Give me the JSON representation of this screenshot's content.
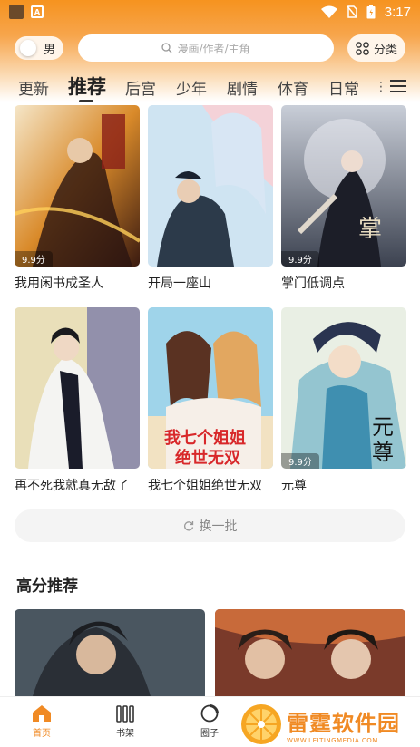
{
  "status_bar": {
    "time": "3:17"
  },
  "top_bar": {
    "gender_label": "男",
    "search_placeholder": "漫画/作者/主角",
    "category_label": "分类"
  },
  "tabs": [
    "更新",
    "推荐",
    "后宫",
    "少年",
    "剧情",
    "体育",
    "日常"
  ],
  "active_tab": "推荐",
  "comics": [
    {
      "title": "我用闲书成圣人",
      "score": "9.9分"
    },
    {
      "title": "开局一座山",
      "score": ""
    },
    {
      "title": "掌门低调点",
      "score": "9.9分"
    },
    {
      "title": "再不死我就真无敌了",
      "score": ""
    },
    {
      "title": "我七个姐姐绝世无双",
      "score": ""
    },
    {
      "title": "元尊",
      "score": "9.9分"
    }
  ],
  "refresh_label": "换一批",
  "section_title": "高分推荐",
  "bottom_nav": [
    {
      "label": "首页",
      "icon": "home-icon",
      "active": true
    },
    {
      "label": "书架",
      "icon": "bookshelf-icon",
      "active": false
    },
    {
      "label": "圈子",
      "icon": "circle-icon",
      "active": false
    }
  ],
  "watermark": {
    "main": "雷霆软件园",
    "sub": "WWW.LEITINGMEDIA.COM"
  },
  "colors": {
    "accent": "#f08a24",
    "header_top": "#f6931f"
  }
}
